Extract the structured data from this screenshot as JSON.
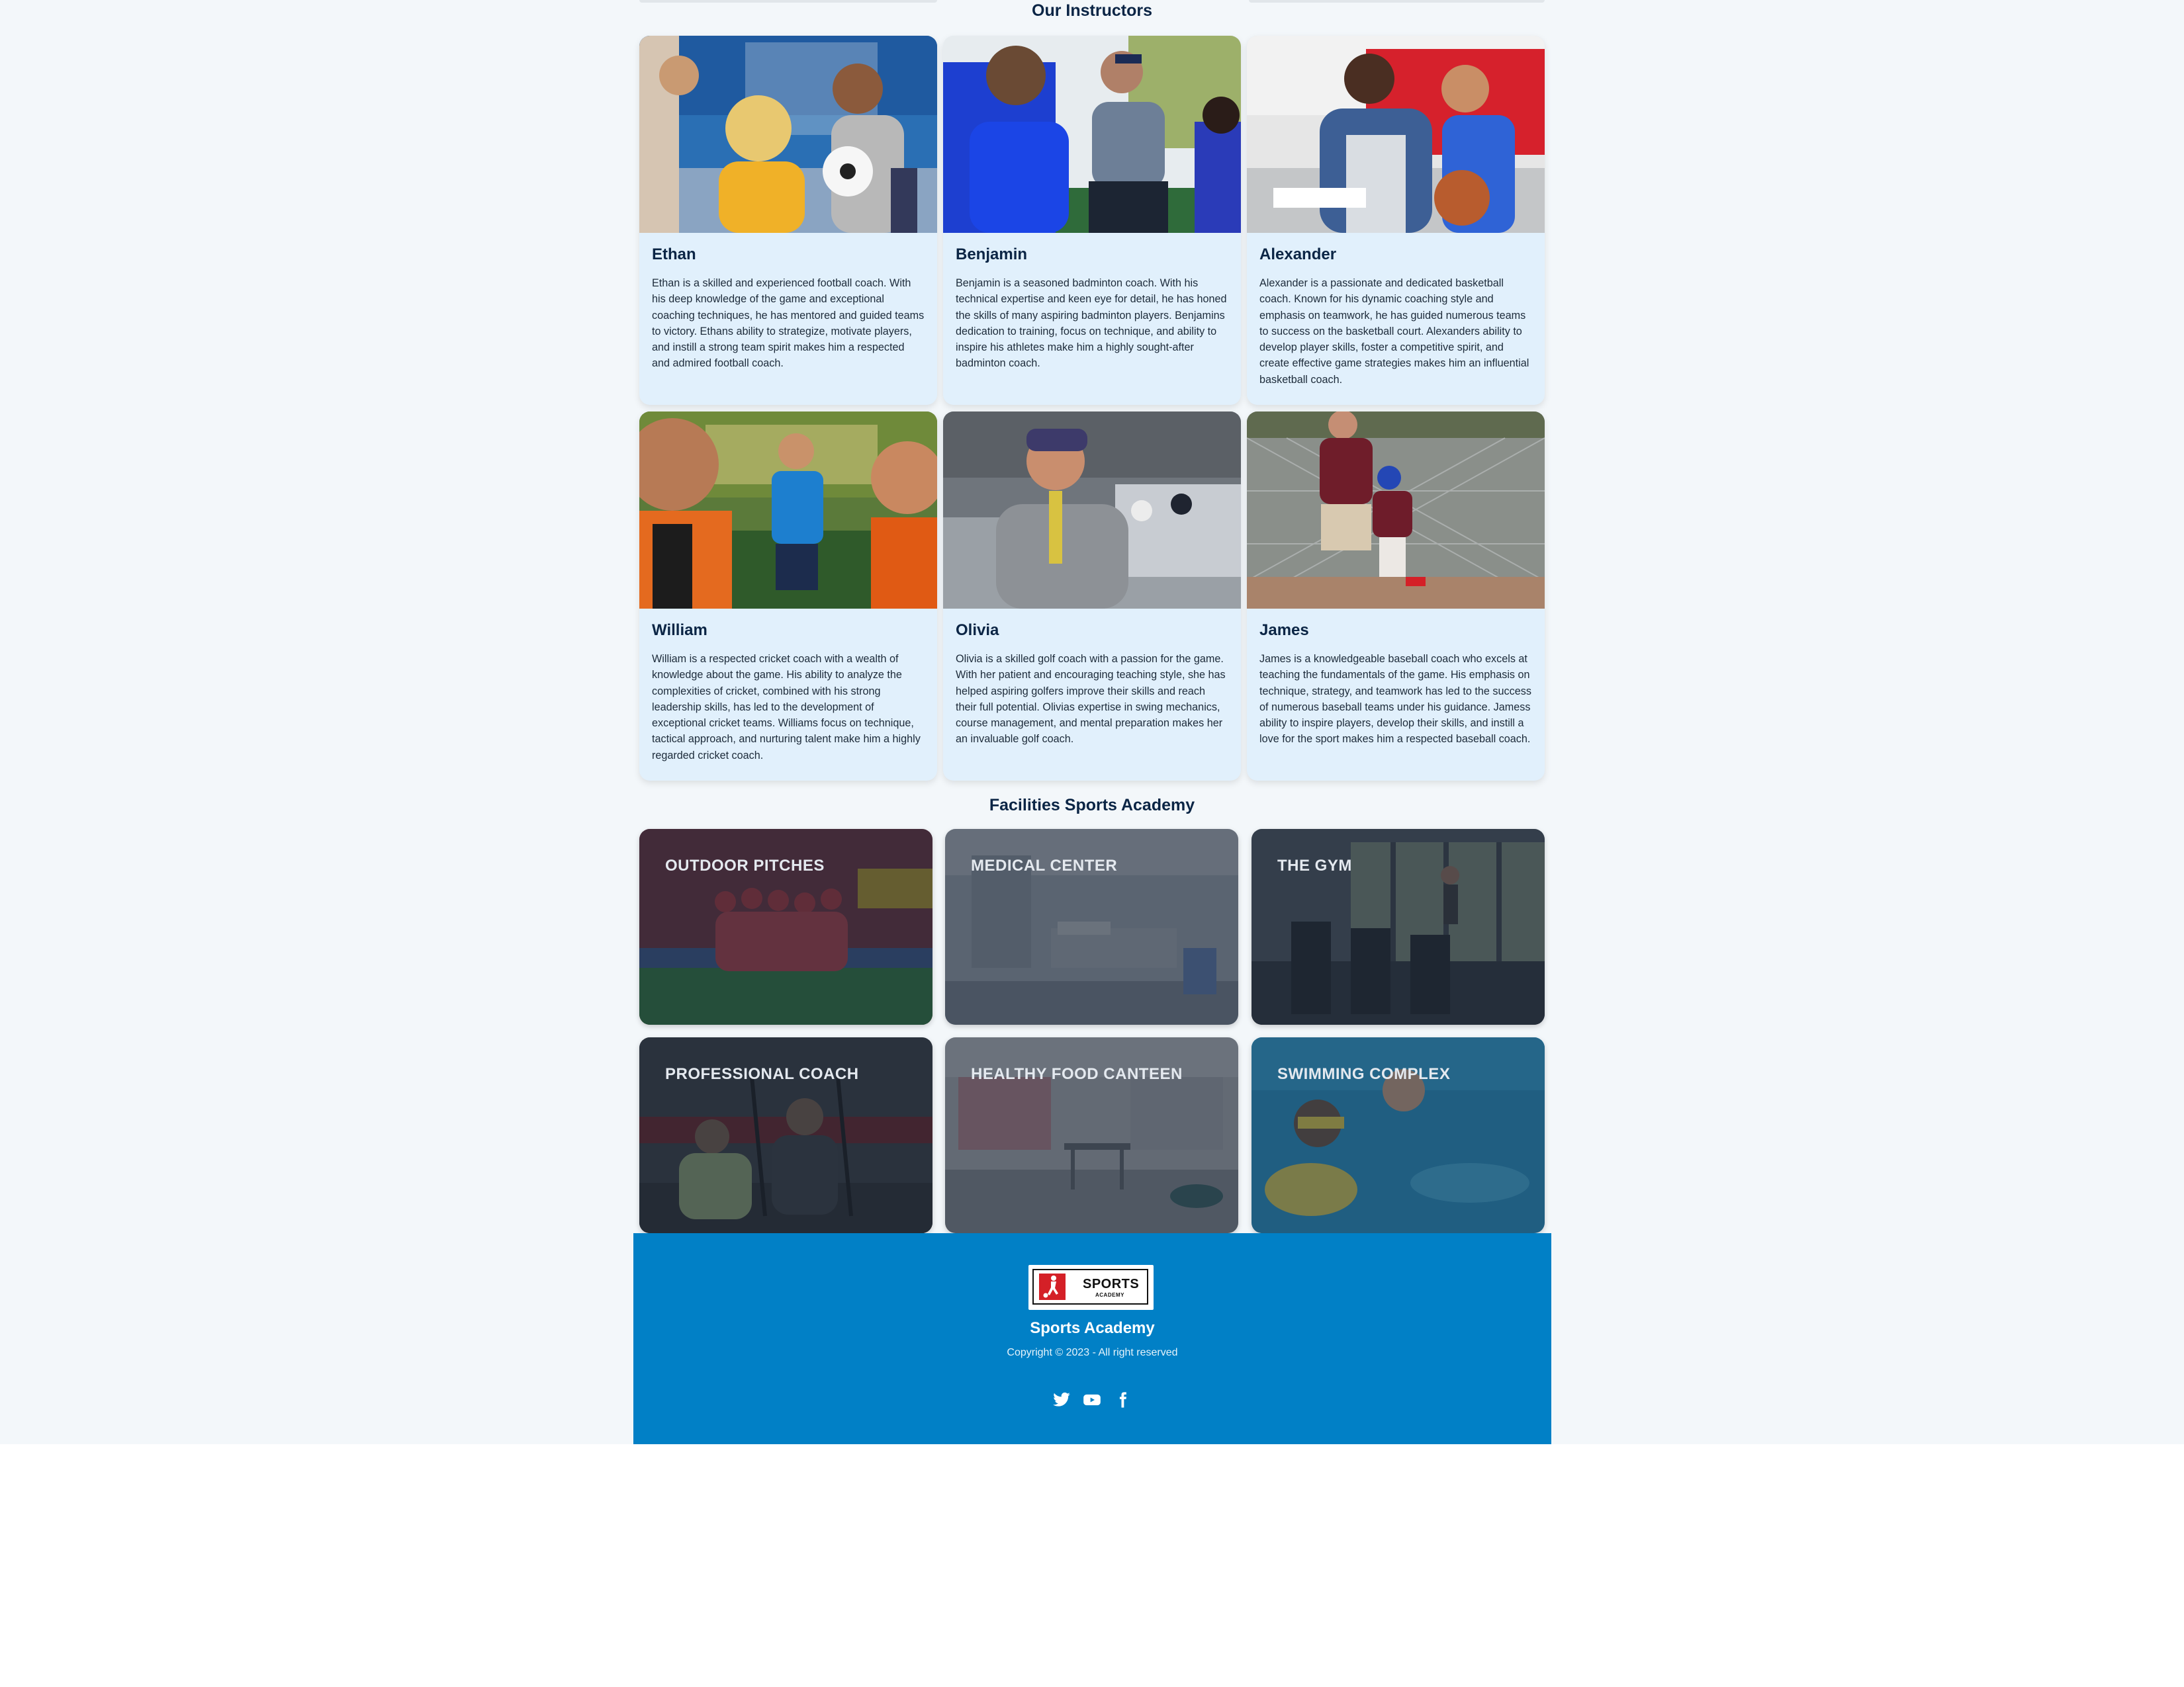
{
  "instructors_section": {
    "title": "Our Instructors",
    "instructors": [
      {
        "name": "Ethan",
        "bio": "Ethan is a skilled and experienced football coach. With his deep knowledge of the game and exceptional coaching techniques, he has mentored and guided teams to victory. Ethans ability to strategize, motivate players, and instill a strong team spirit makes him a respected and admired football coach.",
        "photo_icon": "football-coach-photo"
      },
      {
        "name": "Benjamin",
        "bio": "Benjamin is a seasoned badminton coach. With his technical expertise and keen eye for detail, he has honed the skills of many aspiring badminton players. Benjamins dedication to training, focus on technique, and ability to inspire his athletes make him a highly sought-after badminton coach.",
        "photo_icon": "badminton-coach-photo"
      },
      {
        "name": "Alexander",
        "bio": "Alexander is a passionate and dedicated basketball coach. Known for his dynamic coaching style and emphasis on teamwork, he has guided numerous teams to success on the basketball court. Alexanders ability to develop player skills, foster a competitive spirit, and create effective game strategies makes him an influential basketball coach.",
        "photo_icon": "basketball-coach-photo"
      },
      {
        "name": "William",
        "bio": "William is a respected cricket coach with a wealth of knowledge about the game. His ability to analyze the complexities of cricket, combined with his strong leadership skills, has led to the development of exceptional cricket teams. Williams focus on technique, tactical approach, and nurturing talent make him a highly regarded cricket coach.",
        "photo_icon": "cricket-coach-photo"
      },
      {
        "name": "Olivia",
        "bio": "Olivia is a skilled golf coach with a passion for the game. With her patient and encouraging teaching style, she has helped aspiring golfers improve their skills and reach their full potential. Olivias expertise in swing mechanics, course management, and mental preparation makes her an invaluable golf coach.",
        "photo_icon": "golf-coach-photo"
      },
      {
        "name": "James",
        "bio": "James is a knowledgeable baseball coach who excels at teaching the fundamentals of the game. His emphasis on technique, strategy, and teamwork has led to the success of numerous baseball teams under his guidance. Jamess ability to inspire players, develop their skills, and instill a love for the sport makes him a respected baseball coach.",
        "photo_icon": "baseball-coach-photo"
      }
    ]
  },
  "facilities_section": {
    "title": "Facilities Sports Academy",
    "facilities": [
      {
        "label": "OUTDOOR PITCHES",
        "image_icon": "outdoor-pitch-photo"
      },
      {
        "label": "MEDICAL CENTER",
        "image_icon": "medical-center-photo"
      },
      {
        "label": "THE GYM",
        "image_icon": "gym-photo"
      },
      {
        "label": "PROFESSIONAL COACH",
        "image_icon": "professional-coach-photo"
      },
      {
        "label": "HEALTHY FOOD CANTEEN",
        "image_icon": "canteen-photo"
      },
      {
        "label": "SWIMMING COMPLEX",
        "image_icon": "swimming-photo"
      }
    ]
  },
  "footer": {
    "logo": {
      "text_main": "SPORTS",
      "text_sub": "ACADEMY",
      "icon": "soccer-player-logo-icon"
    },
    "name": "Sports Academy",
    "copyright": "Copyright © 2023 - All right reserved",
    "social": [
      "twitter-icon",
      "youtube-icon",
      "facebook-icon"
    ]
  },
  "colors": {
    "page_background": "#f3f7fa",
    "card_background": "#e1f0fc",
    "heading_text": "#0b2545",
    "footer_background": "#0180c6",
    "logo_red": "#d42027"
  }
}
